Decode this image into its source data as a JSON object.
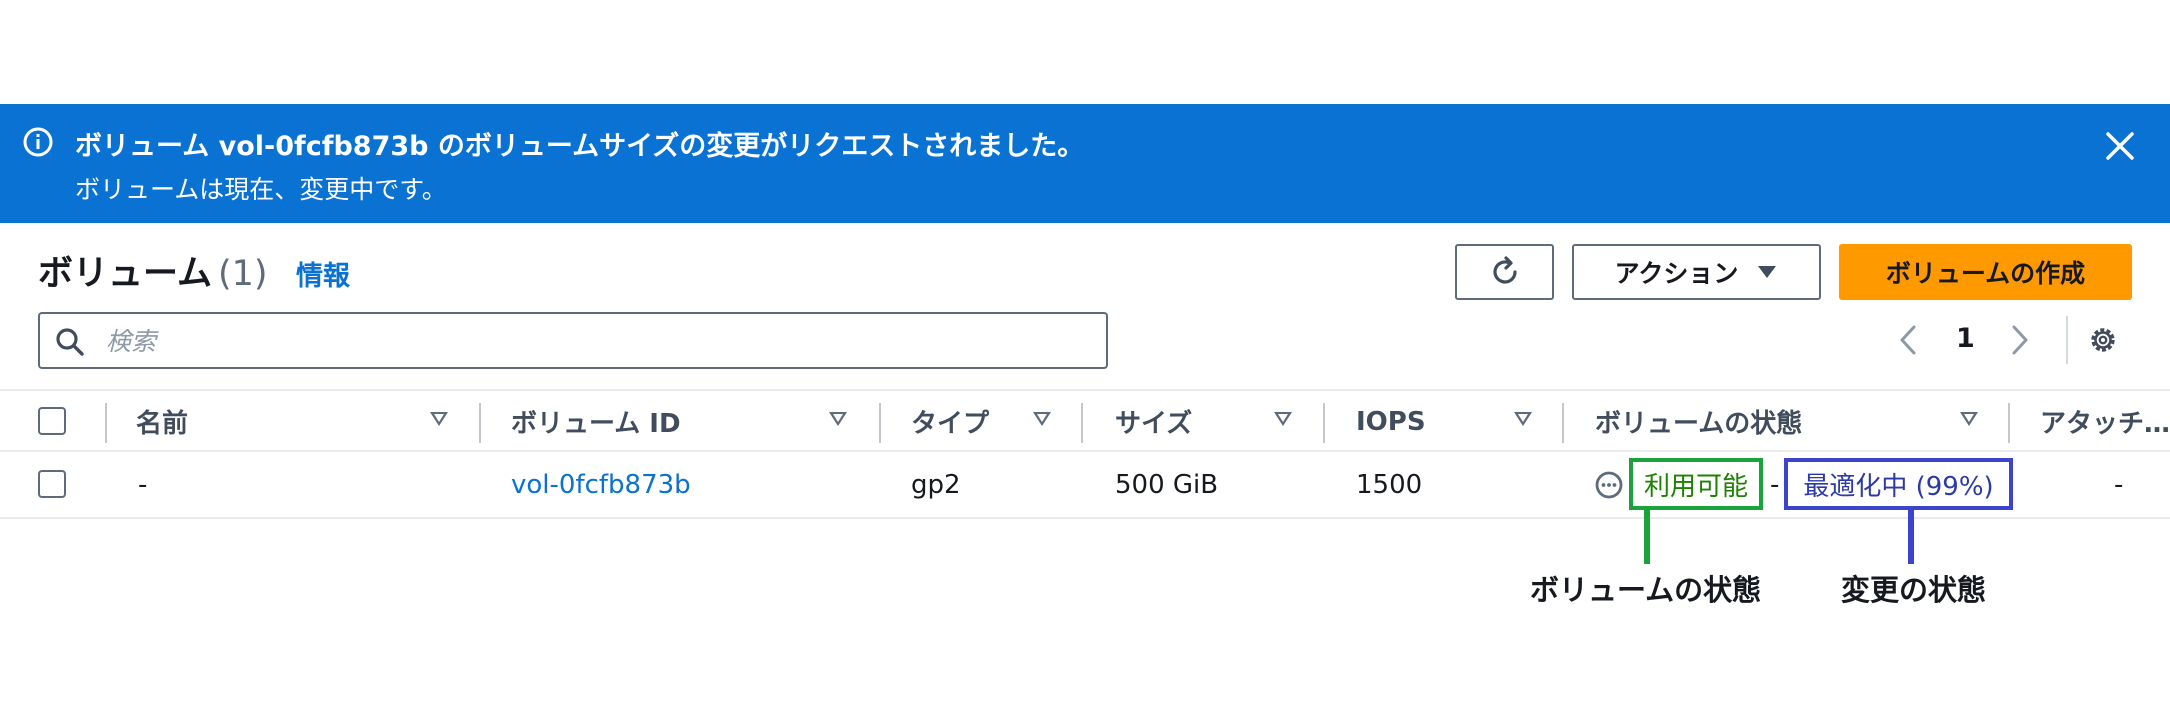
{
  "flash": {
    "message": "ボリューム vol-0fcfb873b のボリュームサイズの変更がリクエストされました。",
    "detail": "ボリュームは現在、変更中です。",
    "icons": {
      "info": "info-icon",
      "close": "close-icon"
    }
  },
  "header": {
    "title": "ボリューム",
    "count": "(1)",
    "info_link": "情報",
    "actions_label": "アクション",
    "create_label": "ボリュームの作成"
  },
  "search": {
    "placeholder": "検索",
    "value": ""
  },
  "pagination": {
    "current_page": "1"
  },
  "table": {
    "columns": [
      "名前",
      "ボリューム ID",
      "タイプ",
      "サイズ",
      "IOPS",
      "ボリュームの状態",
      "アタッチ…"
    ],
    "rows": [
      {
        "name": "-",
        "volume_id": "vol-0fcfb873b",
        "type": "gp2",
        "size": "500 GiB",
        "iops": "1500",
        "volume_state": "利用可能",
        "separator": "-",
        "modification_state": "最適化中 (99%)",
        "attached": "-"
      }
    ]
  },
  "annotations": {
    "volume_state_label": "ボリュームの状態",
    "modification_state_label": "変更の状態"
  },
  "colors": {
    "flash_bg": "#0972d3",
    "primary_button": "#ff9900",
    "link": "#0972d3",
    "available_green": "#1aa33a",
    "modifying_blue": "#3d44cc"
  }
}
